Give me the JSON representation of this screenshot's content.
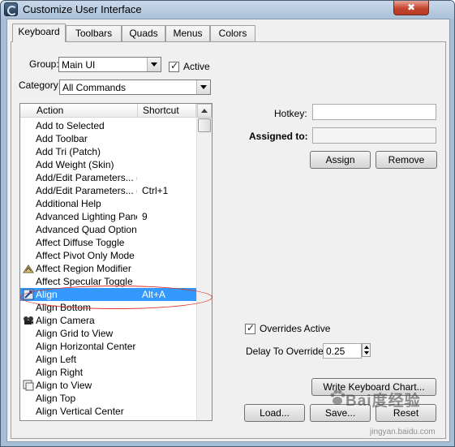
{
  "window": {
    "title": "Customize User Interface",
    "close_glyph": "✖"
  },
  "tabs": [
    {
      "label": "Keyboard",
      "active": true
    },
    {
      "label": "Toolbars",
      "active": false
    },
    {
      "label": "Quads",
      "active": false
    },
    {
      "label": "Menus",
      "active": false
    },
    {
      "label": "Colors",
      "active": false
    }
  ],
  "group": {
    "label": "Group:",
    "value": "Main UI"
  },
  "active_checkbox": {
    "label": "Active",
    "checked": true
  },
  "category": {
    "label": "Category:",
    "value": "All Commands"
  },
  "actions_list": {
    "columns": [
      "Action",
      "Shortcut"
    ],
    "rows": [
      {
        "action": "Add to Selected",
        "shortcut": "",
        "icon": ""
      },
      {
        "action": "Add Toolbar",
        "shortcut": "",
        "icon": ""
      },
      {
        "action": "Add Tri (Patch)",
        "shortcut": "",
        "icon": ""
      },
      {
        "action": "Add Weight (Skin)",
        "shortcut": "",
        "icon": ""
      },
      {
        "action": "Add/Edit Parameters... (",
        "shortcut": "",
        "icon": ""
      },
      {
        "action": "Add/Edit Parameters... (",
        "shortcut": "Ctrl+1",
        "icon": ""
      },
      {
        "action": "Additional Help",
        "shortcut": "",
        "icon": ""
      },
      {
        "action": "Advanced Lighting Panel",
        "shortcut": "9",
        "icon": ""
      },
      {
        "action": "Advanced Quad Option...",
        "shortcut": "",
        "icon": ""
      },
      {
        "action": "Affect Diffuse Toggle",
        "shortcut": "",
        "icon": ""
      },
      {
        "action": "Affect Pivot Only Mode ...",
        "shortcut": "",
        "icon": ""
      },
      {
        "action": "Affect Region Modifier",
        "shortcut": "",
        "icon": "affect-region-icon"
      },
      {
        "action": "Affect Specular Toggle",
        "shortcut": "",
        "icon": ""
      },
      {
        "action": "Align",
        "shortcut": "Alt+A",
        "icon": "align-icon",
        "selected": true
      },
      {
        "action": "Align Bottom",
        "shortcut": "",
        "icon": ""
      },
      {
        "action": "Align Camera",
        "shortcut": "",
        "icon": "align-camera-icon"
      },
      {
        "action": "Align Grid to View",
        "shortcut": "",
        "icon": ""
      },
      {
        "action": "Align Horizontal Center",
        "shortcut": "",
        "icon": ""
      },
      {
        "action": "Align Left",
        "shortcut": "",
        "icon": ""
      },
      {
        "action": "Align Right",
        "shortcut": "",
        "icon": ""
      },
      {
        "action": "Align to View",
        "shortcut": "",
        "icon": "align-to-view-icon"
      },
      {
        "action": "Align Top",
        "shortcut": "",
        "icon": ""
      },
      {
        "action": "Align Vertical Center",
        "shortcut": "",
        "icon": ""
      }
    ]
  },
  "hotkey": {
    "label": "Hotkey:",
    "value": ""
  },
  "assigned_to": {
    "label": "Assigned to:",
    "value": ""
  },
  "buttons": {
    "assign": "Assign",
    "remove": "Remove",
    "write_keyboard_chart": "Write Keyboard Chart...",
    "load": "Load...",
    "save": "Save...",
    "reset": "Reset"
  },
  "overrides_active": {
    "label": "Overrides Active",
    "checked": true
  },
  "delay_to_override": {
    "label": "Delay To Override:",
    "value": "0.25"
  },
  "watermark": {
    "logo": "Bai度经验",
    "url": "jingyan.baidu.com"
  },
  "colors": {
    "selection": "#3399ff",
    "annotation": "#e0302b",
    "titlebar": "#b9cde2"
  }
}
